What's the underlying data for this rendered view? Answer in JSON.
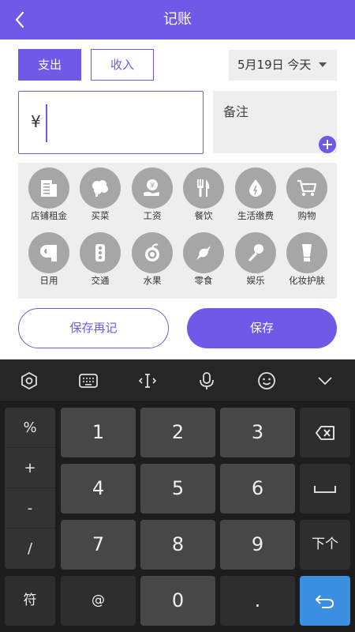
{
  "header": {
    "title": "记账"
  },
  "type_toggle": {
    "expense_label": "支出",
    "income_label": "收入",
    "selected": "expense"
  },
  "date": {
    "label": "5月19日 今天"
  },
  "amount": {
    "currency": "¥",
    "value": ""
  },
  "note": {
    "placeholder": "备注"
  },
  "categories": [
    {
      "label": "店铺租金",
      "icon": "building-icon"
    },
    {
      "label": "买菜",
      "icon": "vegetable-icon"
    },
    {
      "label": "工资",
      "icon": "money-hand-icon"
    },
    {
      "label": "餐饮",
      "icon": "fork-knife-icon"
    },
    {
      "label": "生活缴费",
      "icon": "water-drop-icon"
    },
    {
      "label": "购物",
      "icon": "cart-icon"
    },
    {
      "label": "日用",
      "icon": "tissue-roll-icon"
    },
    {
      "label": "交通",
      "icon": "traffic-light-icon"
    },
    {
      "label": "水果",
      "icon": "fruit-icon"
    },
    {
      "label": "零食",
      "icon": "candy-icon"
    },
    {
      "label": "娱乐",
      "icon": "microphone-icon"
    },
    {
      "label": "化妆护肤",
      "icon": "cosmetic-tube-icon"
    }
  ],
  "actions": {
    "save_again_label": "保存再记",
    "save_label": "保存"
  },
  "keyboard": {
    "toolbar_icons": [
      "settings-hex-icon",
      "keyboard-icon",
      "text-cursor-icon",
      "microphone-icon",
      "emoji-icon",
      "collapse-down-icon"
    ],
    "symbols": [
      "%",
      "+",
      "-",
      "/"
    ],
    "digits": [
      "1",
      "2",
      "3",
      "4",
      "5",
      "6",
      "7",
      "8",
      "9"
    ],
    "bottom": {
      "symbols_key": "符",
      "at_key": "@",
      "zero_key": "0",
      "dot_key": "."
    },
    "next_key": "下个",
    "accent": "#3b8fe0"
  },
  "colors": {
    "primary": "#7059e6",
    "category_icon_bg": "#a6a6a6",
    "panel_bg": "#eeeeee"
  }
}
